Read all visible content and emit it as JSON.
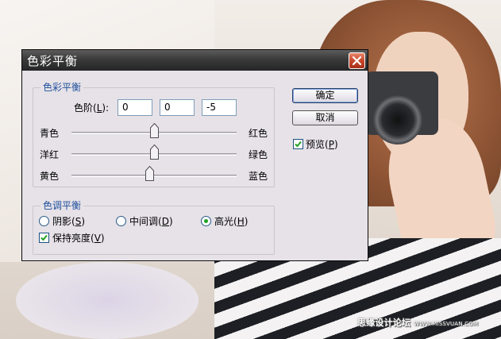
{
  "dialog": {
    "title": "色彩平衡",
    "color_balance_group": {
      "title": "色彩平衡",
      "levels_label": "色阶(",
      "levels_key": "L",
      "levels_suffix": "):",
      "levels": [
        "0",
        "0",
        "-5"
      ]
    },
    "sliders": [
      {
        "left": "青色",
        "right": "红色",
        "value": 0
      },
      {
        "left": "洋红",
        "right": "绿色",
        "value": 0
      },
      {
        "left": "黄色",
        "right": "蓝色",
        "value": -5
      }
    ],
    "tone_group": {
      "title": "色调平衡",
      "shadows": {
        "text": "阴影(",
        "key": "S",
        "suffix": ")",
        "selected": false
      },
      "midtones": {
        "text": "中间调(",
        "key": "D",
        "suffix": ")",
        "selected": false
      },
      "highlights": {
        "text": "高光(",
        "key": "H",
        "suffix": ")",
        "selected": true
      },
      "preserve": {
        "text": "保持亮度(",
        "key": "V",
        "suffix": ")",
        "checked": true
      }
    },
    "ok_label": "确定",
    "cancel_label": "取消",
    "preview": {
      "text": "预览(",
      "key": "P",
      "suffix": ")",
      "checked": true
    }
  },
  "watermark": {
    "text": "思缘设计论坛",
    "site": "WWW.MISSVUAN.COM"
  },
  "colors": {
    "group_title": "#1e4f9c",
    "radio_selected": "#21a121",
    "close_button": "#c8462a"
  }
}
